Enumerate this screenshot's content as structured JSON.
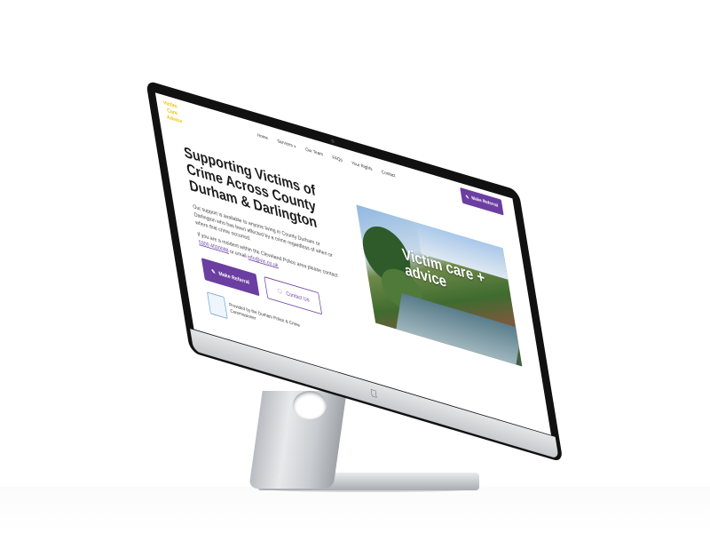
{
  "site": {
    "logo_text": [
      "Victim",
      "Care",
      "Advice"
    ]
  },
  "nav": {
    "items": [
      "Home",
      "Services",
      "Our Team",
      "FAQs",
      "Your Rights",
      "Contact"
    ],
    "cta_label": "Make Referral"
  },
  "hero": {
    "headline": "Supporting Victims of Crime Across County Durham & Darlington",
    "paragraph1": "Our support is available to anyone living in County Durham or Darlington who has been affected by a crime regardless of when or where that crime occurred.",
    "paragraph2_prefix": "If you are a resident within the Cleveland Police area please contact",
    "phone": "0300 4030088",
    "paragraph2_mid": "or email",
    "email": "info@vic.co.uk",
    "refer_button": "Make Referral",
    "contact_button": "Contact Us",
    "provided_by": "Provided by the Durham Police & Crime Commissioner",
    "image_overlay": "Victim care + advice"
  },
  "colors": {
    "brand_purple": "#6b3ea1",
    "logo_yellow": "#f2c200"
  },
  "icons": {
    "referral": "pencil-icon",
    "contact": "chat-bubble-icon",
    "services_dropdown": "chevron-down-icon"
  }
}
